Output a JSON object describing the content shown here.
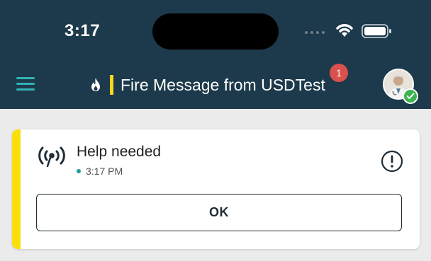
{
  "status_bar": {
    "time": "3:17"
  },
  "header": {
    "title": "Fire Message from USDTest",
    "badge_count": "1",
    "menu_icon": "hamburger-menu-icon",
    "title_icon": "flame-icon",
    "accent_color": "#2fb3b3",
    "background_color": "#1c3a4b"
  },
  "message": {
    "title": "Help needed",
    "time": "3:17 PM",
    "icon": "broadcast-icon",
    "status_icon": "alert-icon",
    "stripe_color": "#fbdf0a",
    "ok_label": "OK"
  }
}
